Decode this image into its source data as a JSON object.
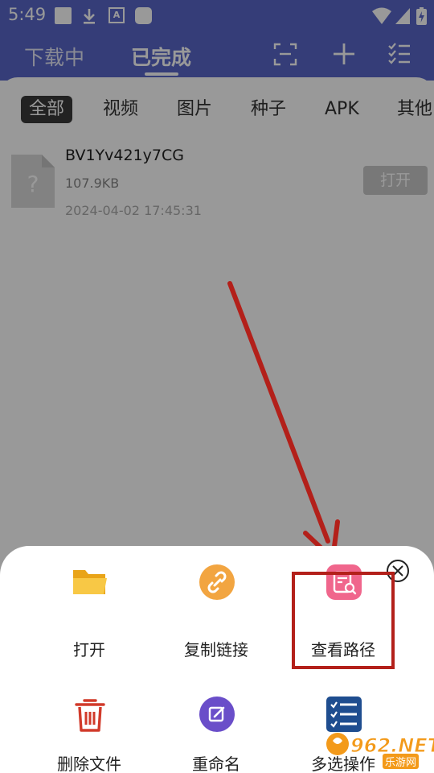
{
  "status_bar": {
    "time": "5:49",
    "font_badge": "A"
  },
  "top_nav": {
    "tabs": [
      {
        "label": "下载中",
        "selected": false
      },
      {
        "label": "已完成",
        "selected": true
      }
    ],
    "icons": [
      "scan-icon",
      "add-icon",
      "checklist-icon"
    ]
  },
  "filters": {
    "items": [
      "全部",
      "视频",
      "图片",
      "种子",
      "APK",
      "其他"
    ],
    "selected": "全部"
  },
  "file": {
    "name": "BV1Yv421y7CG",
    "size": "107.9KB",
    "time": "2024-04-02 17:45:31",
    "open_label": "打开"
  },
  "sheet": {
    "actions": [
      {
        "label": "打开",
        "icon": "folder-icon",
        "color": "#f7b82c"
      },
      {
        "label": "复制链接",
        "icon": "link-icon",
        "color": "#f2a541"
      },
      {
        "label": "查看路径",
        "icon": "view-path-icon",
        "color": "#f0668c"
      },
      {
        "label": "删除文件",
        "icon": "trash-icon",
        "color": "#d13a2a"
      },
      {
        "label": "重命名",
        "icon": "edit-icon",
        "color": "#6a4ec9"
      },
      {
        "label": "多选操作",
        "icon": "multi-select-icon",
        "color": "#1e4d8f"
      }
    ],
    "highlighted": "查看路径"
  },
  "colors": {
    "brand": "#5967c9",
    "annotation": "#b3201a"
  },
  "watermark": {
    "text": "962.NET",
    "sub": "乐游网"
  }
}
